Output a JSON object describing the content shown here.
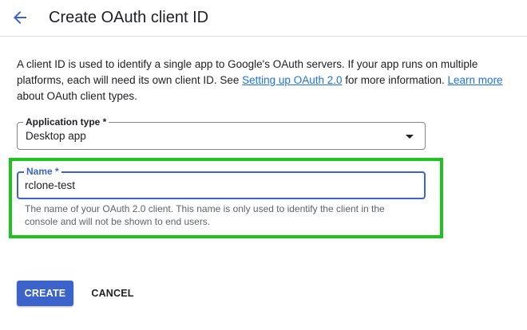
{
  "header": {
    "back_icon": "arrow-back-icon",
    "title": "Create OAuth client ID"
  },
  "description": {
    "part1": "A client ID is used to identify a single app to Google's OAuth servers. If your app runs on multiple platforms, each will need its own client ID. See ",
    "link1": "Setting up OAuth 2.0",
    "part2": " for more information. ",
    "link2": "Learn more",
    "part3": " about OAuth client types."
  },
  "application_type": {
    "label": "Application type *",
    "value": "Desktop app",
    "icon": "dropdown-arrow-icon"
  },
  "name": {
    "label": "Name *",
    "value": "rclone-test",
    "helper": "The name of your OAuth 2.0 client. This name is only used to identify the client in the console and will not be shown to end users."
  },
  "actions": {
    "create": "CREATE",
    "cancel": "CANCEL"
  },
  "colors": {
    "accent": "#3c63c9",
    "link": "#1a73e8",
    "highlight": "#1ec31e"
  }
}
